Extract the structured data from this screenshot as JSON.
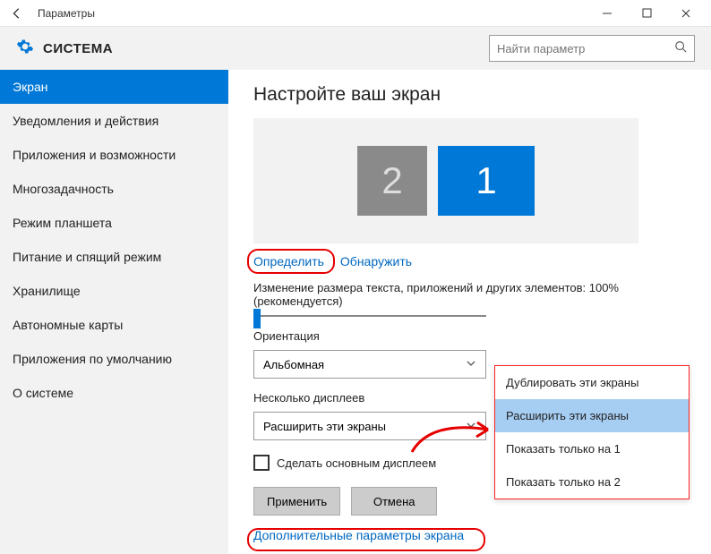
{
  "window": {
    "title": "Параметры"
  },
  "header": {
    "section": "СИСТЕМА",
    "search_placeholder": "Найти параметр"
  },
  "sidebar": {
    "items": [
      {
        "label": "Экран",
        "active": true
      },
      {
        "label": "Уведомления и действия"
      },
      {
        "label": "Приложения и возможности"
      },
      {
        "label": "Многозадачность"
      },
      {
        "label": "Режим планшета"
      },
      {
        "label": "Питание и спящий режим"
      },
      {
        "label": "Хранилище"
      },
      {
        "label": "Автономные карты"
      },
      {
        "label": "Приложения по умолчанию"
      },
      {
        "label": "О системе"
      }
    ]
  },
  "main": {
    "heading": "Настройте ваш экран",
    "monitors": {
      "m2": "2",
      "m1": "1"
    },
    "identify": "Определить",
    "detect": "Обнаружить",
    "scale_label": "Изменение размера текста, приложений и других элементов: 100% (рекомендуется)",
    "orientation_label": "Ориентация",
    "orientation_value": "Альбомная",
    "multiple_label": "Несколько дисплеев",
    "multiple_value": "Расширить эти экраны",
    "make_primary": "Сделать основным дисплеем",
    "apply": "Применить",
    "cancel": "Отмена",
    "advanced": "Дополнительные параметры экрана"
  },
  "dropdown": {
    "options": [
      {
        "label": "Дублировать эти экраны"
      },
      {
        "label": "Расширить эти экраны",
        "selected": true
      },
      {
        "label": "Показать только на 1"
      },
      {
        "label": "Показать только на 2"
      }
    ]
  }
}
